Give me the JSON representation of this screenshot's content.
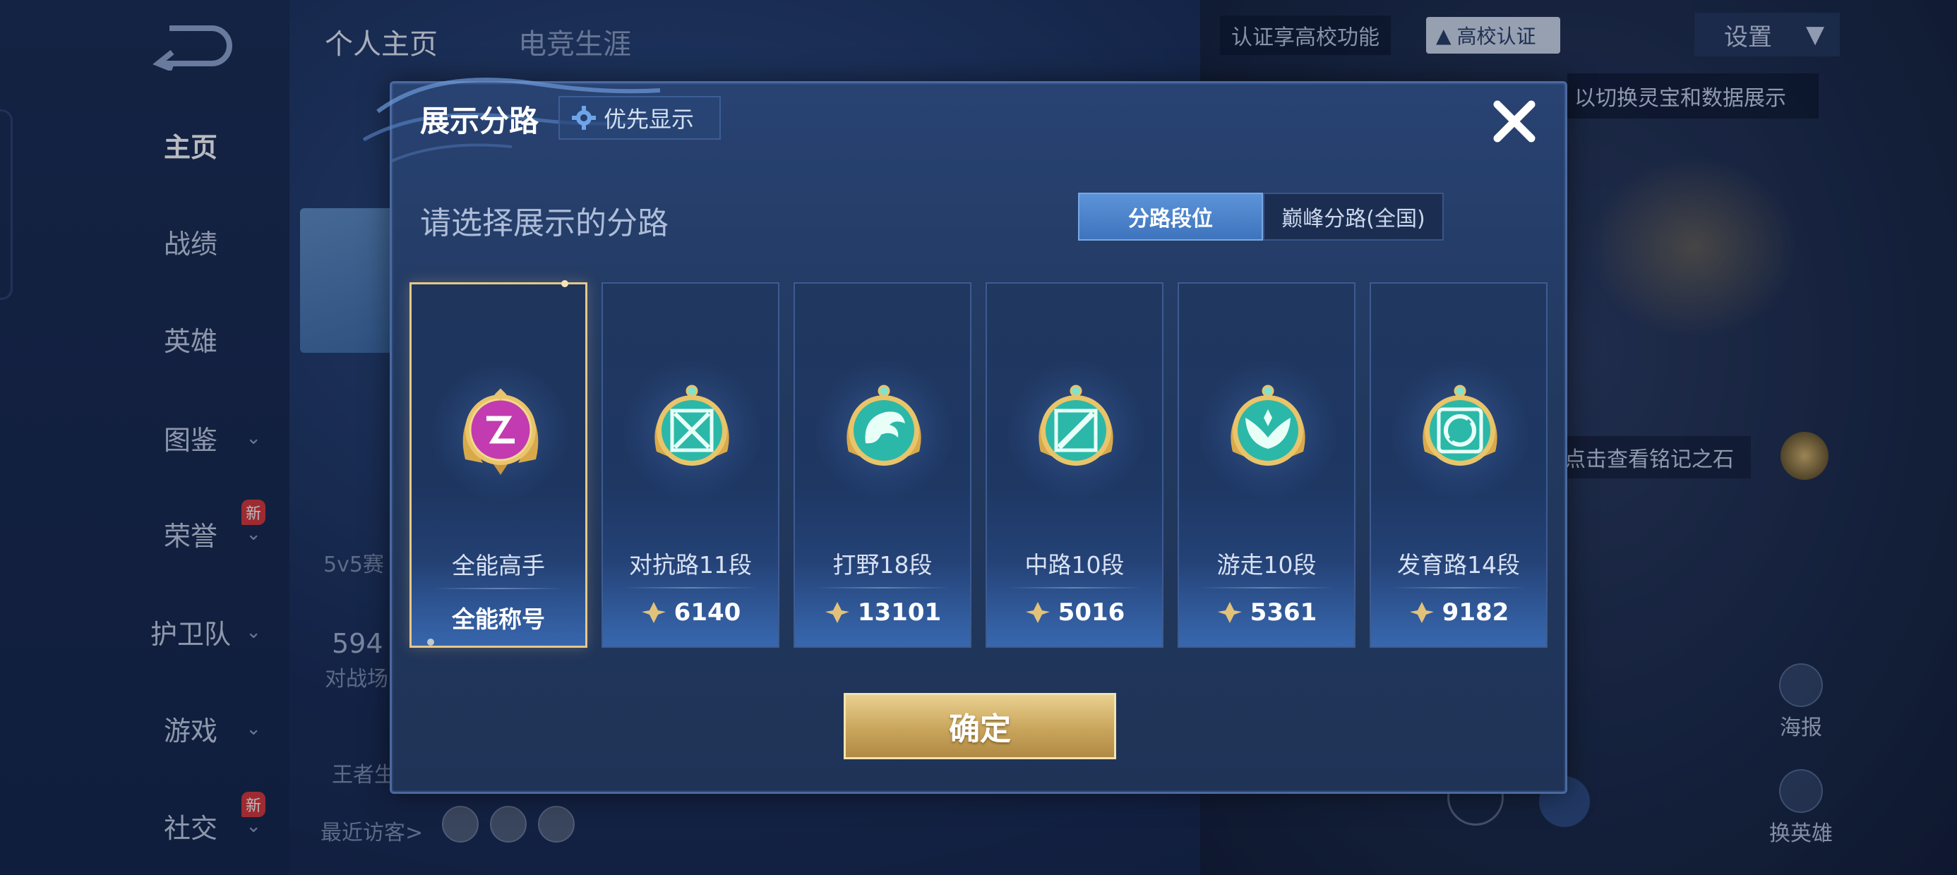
{
  "nav": {
    "items": [
      {
        "label": "主页",
        "active": true
      },
      {
        "label": "战绩"
      },
      {
        "label": "英雄"
      },
      {
        "label": "图鉴"
      },
      {
        "label": "荣誉"
      },
      {
        "label": "护卫队"
      },
      {
        "label": "游戏"
      },
      {
        "label": "社交"
      }
    ],
    "new_badge": "新"
  },
  "background": {
    "tabs": [
      "个人主页",
      "电竞生涯"
    ],
    "cert_text": "认证享高校功能",
    "cert_badge": "高校认证",
    "settings": "设置",
    "hint_top": "以切换灵宝和数据展示",
    "hint_stone": "点击查看铭记之石",
    "mode_text": "5v5赛",
    "count_text": "594",
    "count_label": "对战场",
    "king_text": "王者生",
    "recent_visitors": "最近访客>",
    "side_buttons": [
      "海报",
      "换英雄"
    ]
  },
  "modal": {
    "title": "展示分路",
    "priority_label": "优先显示",
    "prompt": "请选择展示的分路",
    "toggle": {
      "active": "分路段位",
      "inactive": "巅峰分路(全国)"
    },
    "confirm": "确定",
    "cards": [
      {
        "name": "全能高手",
        "tag": "全能称号",
        "selected": true,
        "color": "#c23bb0"
      },
      {
        "name": "对抗路11段",
        "points": "6140",
        "color": "#2bb8a8"
      },
      {
        "name": "打野18段",
        "points": "13101",
        "color": "#2bb8a8"
      },
      {
        "name": "中路10段",
        "points": "5016",
        "color": "#2bb8a8"
      },
      {
        "name": "游走10段",
        "points": "5361",
        "color": "#2bb8a8"
      },
      {
        "name": "发育路14段",
        "points": "9182",
        "color": "#2bb8a8"
      }
    ]
  },
  "colors": {
    "accent_gold": "#e6c88a",
    "toggle_active": "#4a82cc",
    "emblem_teal": "#2bb8a8",
    "emblem_magenta": "#c23bb0"
  }
}
